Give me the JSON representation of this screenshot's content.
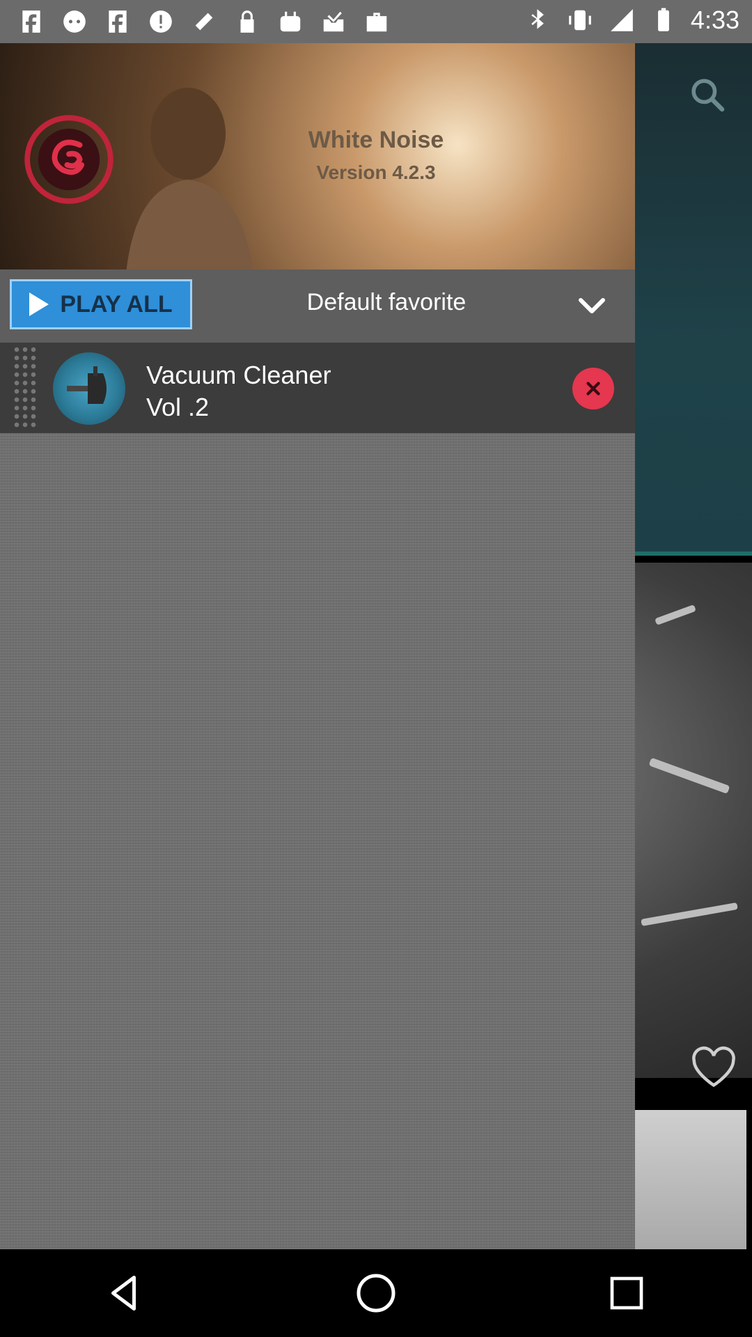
{
  "status_bar": {
    "time": "4:33",
    "icons_left": [
      "f-icon",
      "face-icon",
      "f-icon",
      "info-icon",
      "satellite-icon",
      "lock-icon",
      "bag-icon",
      "inbox-icon",
      "briefcase-icon"
    ],
    "icons_right": [
      "bluetooth-icon",
      "vibrate-icon",
      "signal-icon",
      "battery-icon"
    ]
  },
  "drawer": {
    "app_name": "White Noise",
    "app_version": "Version 4.2.3",
    "play_all_label": "PLAY ALL",
    "playlist_name": "Default favorite",
    "songs": [
      {
        "title": "Vacuum Cleaner",
        "subtitle": "Vol .2"
      }
    ]
  },
  "background_app": {
    "tab_fragment": "N"
  },
  "colors": {
    "accent_blue": "#2f8fd8",
    "remove_red": "#e5374f",
    "teal": "#1f6e6a"
  }
}
